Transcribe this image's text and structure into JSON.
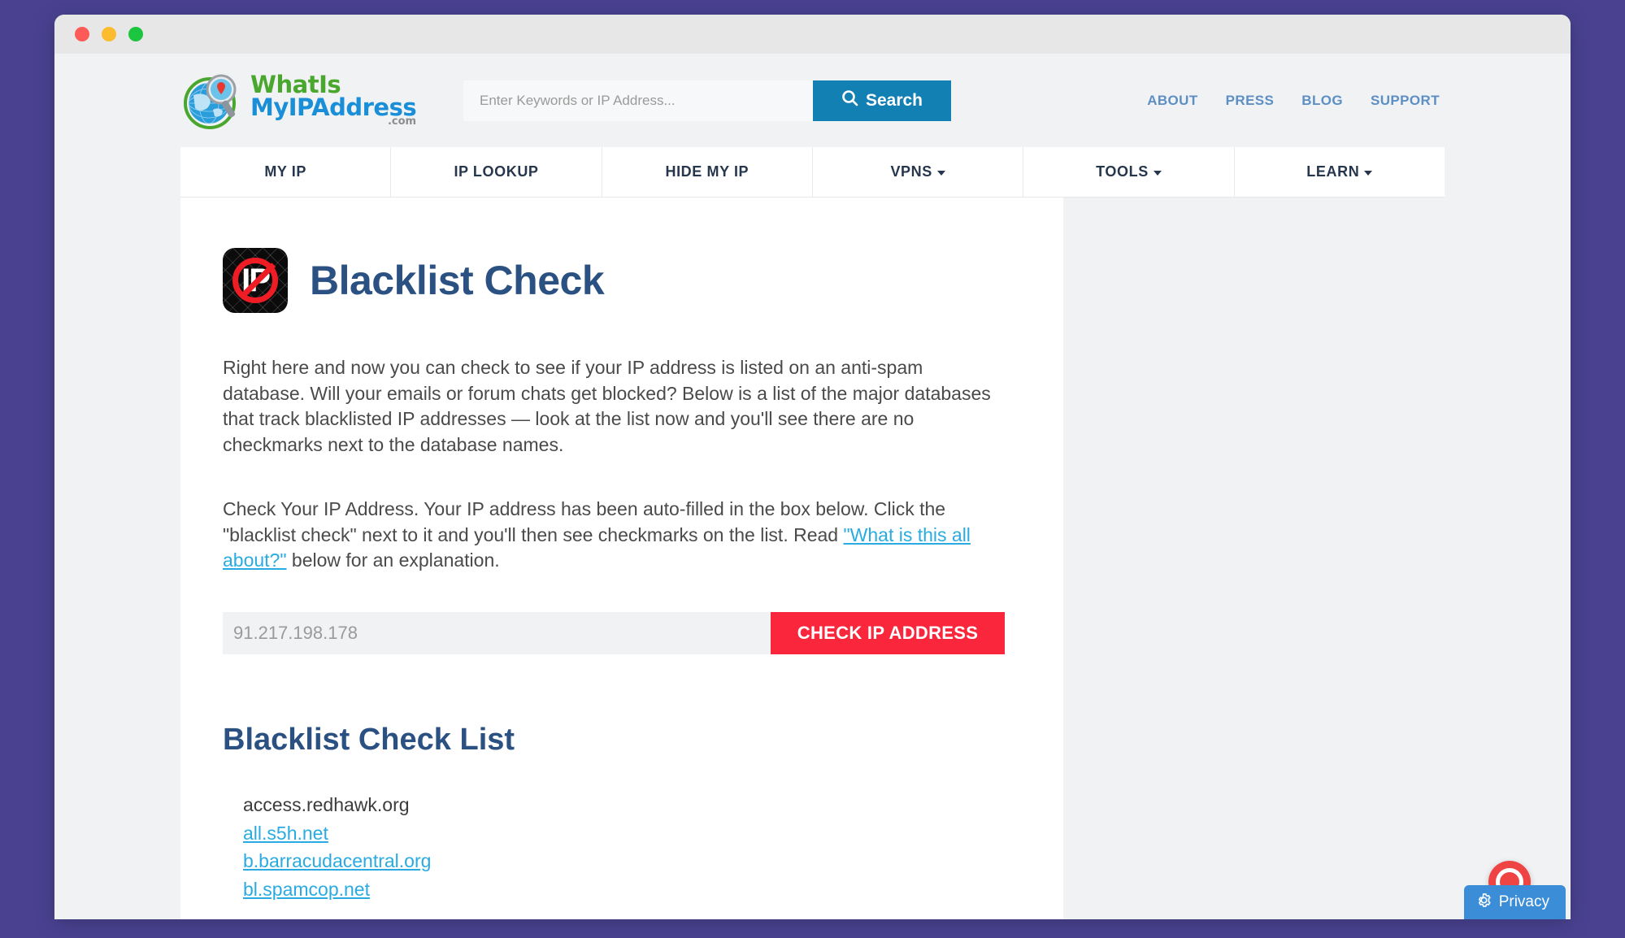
{
  "window": {
    "traffic_lights": [
      "close",
      "minimize",
      "maximize"
    ]
  },
  "header": {
    "logo": {
      "line1": "WhatIs",
      "line2": "MyIPAddress",
      "tld": ".com",
      "icon": "globe-magnifier-logo"
    },
    "search": {
      "placeholder": "Enter Keywords or IP Address...",
      "value": "",
      "button_label": "Search",
      "button_color": "#1380b4"
    },
    "top_links": [
      {
        "label": "ABOUT"
      },
      {
        "label": "PRESS"
      },
      {
        "label": "BLOG"
      },
      {
        "label": "SUPPORT"
      }
    ]
  },
  "nav": {
    "items": [
      {
        "label": "MY IP",
        "has_dropdown": false
      },
      {
        "label": "IP LOOKUP",
        "has_dropdown": false
      },
      {
        "label": "HIDE MY IP",
        "has_dropdown": false
      },
      {
        "label": "VPNS",
        "has_dropdown": true
      },
      {
        "label": "TOOLS",
        "has_dropdown": true
      },
      {
        "label": "LEARN",
        "has_dropdown": true
      }
    ]
  },
  "main": {
    "page_title": "Blacklist Check",
    "page_icon": "blacklisted-ip-icon",
    "icon_letters": "IP",
    "paragraph1": "Right here and now you can check to see if your IP address is listed on an anti-spam database. Will your emails or forum chats get blocked? Below is a list of the major databases that track blacklisted IP addresses — look at the list now and you'll see there are no checkmarks next to the database names.",
    "paragraph2": {
      "part1": "Check Your IP Address. Your IP address has been auto-filled in the box below. Click the \"blacklist check\" next to it and you'll then see checkmarks on the list. Read ",
      "link": "\"What is this all about?\"",
      "part2": " below for an explanation."
    },
    "ip_form": {
      "value": "91.217.198.178",
      "placeholder": "Enter IP Address",
      "button_label": "CHECK IP ADDRESS",
      "button_color": "#f9263c"
    },
    "list_title": "Blacklist Check List",
    "blacklist_items": [
      {
        "label": "access.redhawk.org",
        "is_link": false
      },
      {
        "label": "all.s5h.net",
        "is_link": true
      },
      {
        "label": "b.barracudacentral.org",
        "is_link": true
      },
      {
        "label": "bl.spamcop.net",
        "is_link": true
      }
    ]
  },
  "widgets": {
    "chat": "support-chat-bubble",
    "privacy_label": "Privacy",
    "privacy_icon": "gear-icon"
  },
  "colors": {
    "page_background": "#4a4291",
    "brand_blue": "#2b5182",
    "link_blue": "#29abe2",
    "accent_red": "#f9263c",
    "search_blue": "#1380b4"
  }
}
